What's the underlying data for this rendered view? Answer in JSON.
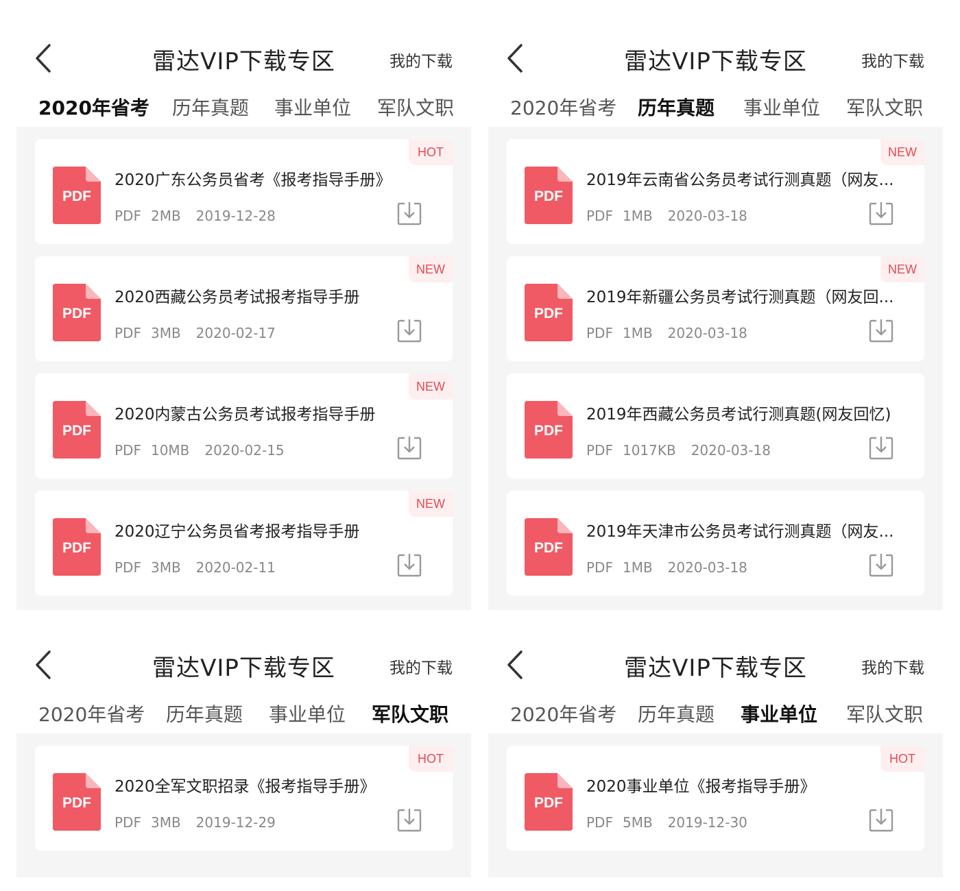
{
  "header": {
    "title": "雷达VIP下载专区",
    "my_downloads": "我的下载"
  },
  "tabs": [
    "2020年省考",
    "历年真题",
    "事业单位",
    "军队文职"
  ],
  "colors": {
    "accent": "#ee4a55",
    "pdf": "#f05a64",
    "badge_bg": "#fdeff0",
    "badge_text": "#e34b53"
  },
  "icons": {
    "back": "chevron-left-icon",
    "download": "download-icon",
    "file": "pdf-file-icon"
  },
  "panels": [
    {
      "active_tab": 0,
      "files": [
        {
          "title": "2020广东公务员省考《报考指导手册》",
          "type": "PDF",
          "size": "2MB",
          "date": "2019-12-28",
          "badge": "HOT"
        },
        {
          "title": "2020西藏公务员考试报考指导手册",
          "type": "PDF",
          "size": "3MB",
          "date": "2020-02-17",
          "badge": "NEW"
        },
        {
          "title": "2020内蒙古公务员考试报考指导手册",
          "type": "PDF",
          "size": "10MB",
          "date": "2020-02-15",
          "badge": "NEW"
        },
        {
          "title": "2020辽宁公务员省考报考指导手册",
          "type": "PDF",
          "size": "3MB",
          "date": "2020-02-11",
          "badge": "NEW"
        }
      ]
    },
    {
      "active_tab": 1,
      "files": [
        {
          "title": "2019年云南省公务员考试行测真题（网友...",
          "type": "PDF",
          "size": "1MB",
          "date": "2020-03-18",
          "badge": "NEW"
        },
        {
          "title": "2019年新疆公务员考试行测真题（网友回...",
          "type": "PDF",
          "size": "1MB",
          "date": "2020-03-18",
          "badge": "NEW"
        },
        {
          "title": "2019年西藏公务员考试行测真题(网友回忆)",
          "type": "PDF",
          "size": "1017KB",
          "date": "2020-03-18",
          "badge": ""
        },
        {
          "title": "2019年天津市公务员考试行测真题（网友...",
          "type": "PDF",
          "size": "1MB",
          "date": "2020-03-18",
          "badge": ""
        }
      ]
    },
    {
      "active_tab": 3,
      "files": [
        {
          "title": "2020全军文职招录《报考指导手册》",
          "type": "PDF",
          "size": "3MB",
          "date": "2019-12-29",
          "badge": "HOT"
        }
      ]
    },
    {
      "active_tab": 2,
      "files": [
        {
          "title": "2020事业单位《报考指导手册》",
          "type": "PDF",
          "size": "5MB",
          "date": "2019-12-30",
          "badge": "HOT"
        }
      ]
    }
  ]
}
